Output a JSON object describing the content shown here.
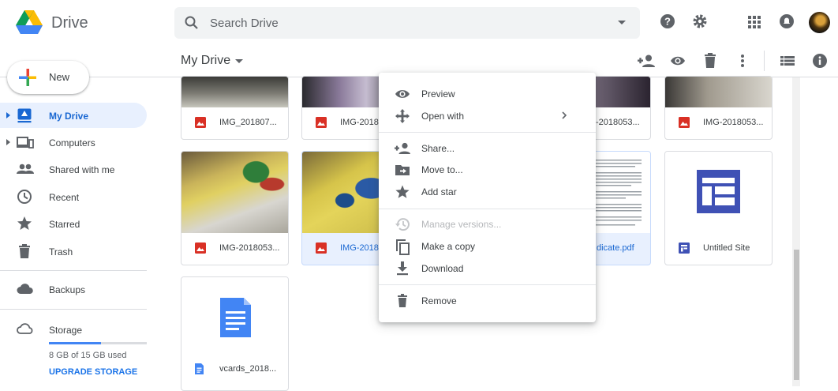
{
  "app": {
    "name": "Drive"
  },
  "search": {
    "placeholder": "Search Drive"
  },
  "toolbar": {
    "location": "My Drive"
  },
  "sidebar": {
    "new_label": "New",
    "items": [
      {
        "label": "My Drive",
        "icon": "drive-icon",
        "active": true
      },
      {
        "label": "Computers",
        "icon": "computers-icon"
      },
      {
        "label": "Shared with me",
        "icon": "people-icon"
      },
      {
        "label": "Recent",
        "icon": "clock-icon"
      },
      {
        "label": "Starred",
        "icon": "star-icon"
      },
      {
        "label": "Trash",
        "icon": "trash-icon"
      },
      {
        "label": "Backups",
        "icon": "cloud-icon"
      },
      {
        "label": "Storage",
        "icon": "cloud-outline-icon"
      }
    ],
    "storage": {
      "used": "8 GB of 15 GB used",
      "upgrade": "UPGRADE STORAGE",
      "fraction": 0.53
    }
  },
  "files": [
    {
      "name": "IMG_201807...",
      "icon": "image-icon"
    },
    {
      "name": "IMG-2018",
      "icon": "image-icon"
    },
    {
      "name": "-2018053...",
      "icon": "image-icon"
    },
    {
      "name": "IMG-2018053...",
      "icon": "image-icon"
    },
    {
      "name": "IMG-2018053...",
      "icon": "image-icon"
    },
    {
      "name": "IMG-2018",
      "icon": "image-icon",
      "selected": true
    },
    {
      "name": "dicate.pdf",
      "icon": "pdf-icon"
    },
    {
      "name": "Untitled Site",
      "icon": "sites-icon"
    },
    {
      "name": "vcards_2018...",
      "icon": "docs-icon"
    }
  ],
  "context_menu": {
    "items": [
      {
        "label": "Preview",
        "icon": "eye-icon"
      },
      {
        "label": "Open with",
        "icon": "open-with-icon",
        "submenu": true
      },
      {
        "label": "Share...",
        "icon": "person-add-icon"
      },
      {
        "label": "Move to...",
        "icon": "move-to-icon"
      },
      {
        "label": "Add star",
        "icon": "star-icon"
      },
      {
        "label": "Manage versions...",
        "icon": "history-icon",
        "disabled": true
      },
      {
        "label": "Make a copy",
        "icon": "copy-icon"
      },
      {
        "label": "Download",
        "icon": "download-icon"
      },
      {
        "label": "Remove",
        "icon": "trash-icon"
      }
    ]
  },
  "colors": {
    "accent": "#1a73e8",
    "active_bg": "#e8f0fe",
    "image_icon": "#d93025",
    "docs_blue": "#4285f4",
    "sites_blue": "#3f51b5"
  }
}
